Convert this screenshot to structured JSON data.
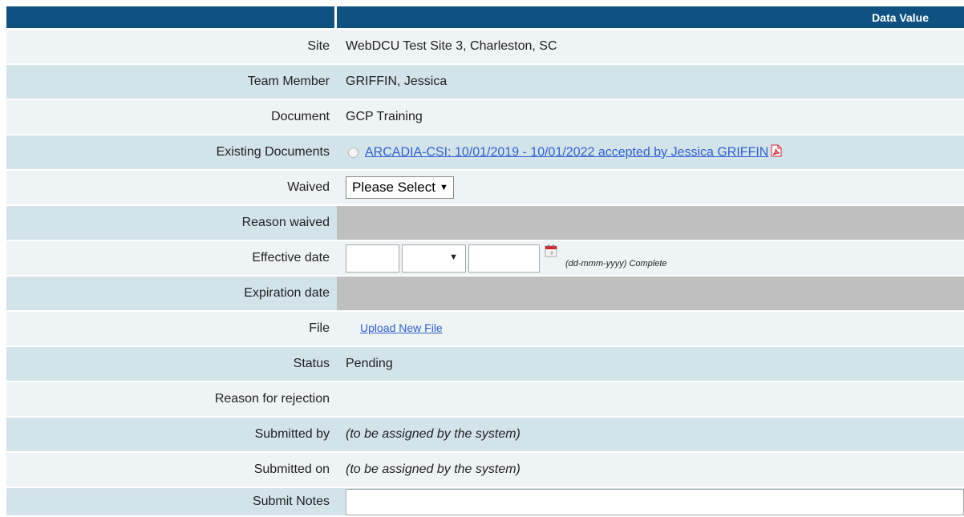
{
  "header": {
    "data_value_label": "Data Value"
  },
  "fields": {
    "site": {
      "label": "Site",
      "value": "WebDCU Test Site 3, Charleston, SC"
    },
    "team_member": {
      "label": "Team Member",
      "value": "GRIFFIN, Jessica"
    },
    "document": {
      "label": "Document",
      "value": "GCP Training"
    },
    "existing_documents": {
      "label": "Existing Documents",
      "link": "ARCADIA-CSI: 10/01/2019 - 10/01/2022 accepted by Jessica GRIFFIN",
      "icon": "pdf-icon"
    },
    "waived": {
      "label": "Waived",
      "selected": "Please Select"
    },
    "reason_waived": {
      "label": "Reason waived"
    },
    "effective_date": {
      "label": "Effective date",
      "day": "",
      "month": "",
      "year": "",
      "hint": "(dd-mmm-yyyy) Complete",
      "icon": "calendar-icon"
    },
    "expiration_date": {
      "label": "Expiration date"
    },
    "file": {
      "label": "File",
      "link": "Upload New File"
    },
    "status": {
      "label": "Status",
      "value": "Pending"
    },
    "reason_rejection": {
      "label": "Reason for rejection",
      "value": ""
    },
    "submitted_by": {
      "label": "Submitted by",
      "value": "(to be assigned by the system)"
    },
    "submitted_on": {
      "label": "Submitted on",
      "value": "(to be assigned by the system)"
    },
    "submit_notes": {
      "label": "Submit Notes",
      "value": ""
    }
  },
  "colors": {
    "header_bg": "#0f5181",
    "row_light": "#eef3f5",
    "row_dark": "#d3e3ea",
    "disabled": "#bfbfbf",
    "link": "#2f5fd0",
    "icon_red": "#d8262d"
  }
}
